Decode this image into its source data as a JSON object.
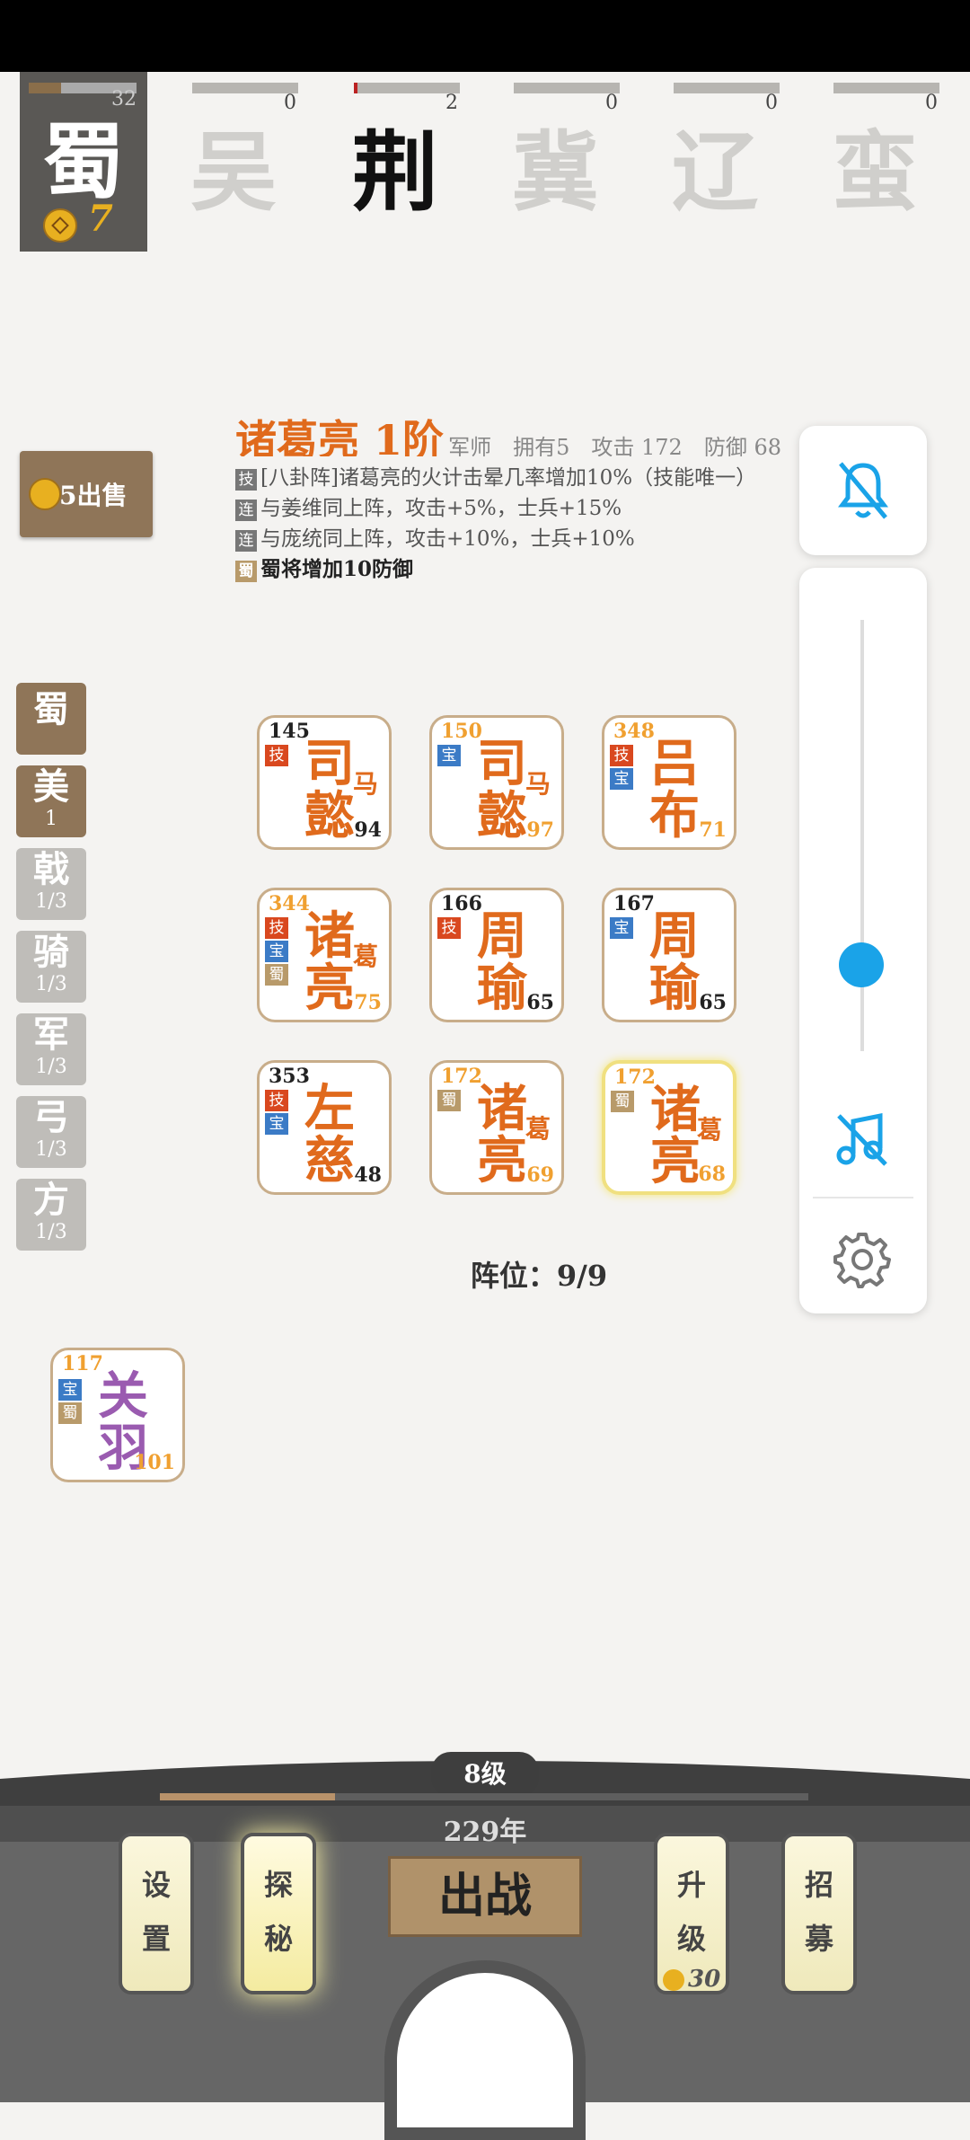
{
  "factions": [
    {
      "name": "蜀",
      "count": "32",
      "gold": "7",
      "progress": 0.3
    },
    {
      "name": "吴",
      "count": "0",
      "progress": 0
    },
    {
      "name": "荆",
      "count": "2",
      "progress": 0.03
    },
    {
      "name": "冀",
      "count": "0",
      "progress": 0
    },
    {
      "name": "辽",
      "count": "0",
      "progress": 0
    },
    {
      "name": "蛮",
      "count": "0",
      "progress": 0
    }
  ],
  "sell": {
    "label": "5出售"
  },
  "hero": {
    "name": "诸葛亮 1阶",
    "stats": "军师　拥有5　攻击 172　防御 68",
    "lines": [
      {
        "tag": "技",
        "text": "[八卦阵]诸葛亮的火计击晕几率增加10%（技能唯一）"
      },
      {
        "tag": "连",
        "text": "与姜维同上阵，攻击+5%，士兵+15%"
      },
      {
        "tag": "连",
        "text": "与庞统同上阵，攻击+10%，士兵+10%"
      },
      {
        "tag": "蜀",
        "text": "蜀将增加10防御"
      }
    ]
  },
  "filters": [
    {
      "t": "蜀",
      "s": ""
    },
    {
      "t": "美",
      "s": "1"
    },
    {
      "t": "戟",
      "s": "1/3"
    },
    {
      "t": "骑",
      "s": "1/3"
    },
    {
      "t": "军",
      "s": "1/3"
    },
    {
      "t": "弓",
      "s": "1/3"
    },
    {
      "t": "方",
      "s": "1/3"
    }
  ],
  "cards": [
    {
      "lv": "145",
      "c1": "司",
      "c2": "懿",
      "c3": "马",
      "pw": "94",
      "badges": [
        "技"
      ],
      "orange": false
    },
    {
      "lv": "150",
      "c1": "司",
      "c2": "懿",
      "c3": "马",
      "pw": "97",
      "badges": [
        "宝"
      ],
      "orange": true
    },
    {
      "lv": "348",
      "c1": "吕",
      "c2": "布",
      "c3": "",
      "pw": "71",
      "badges": [
        "技",
        "宝"
      ],
      "orange": true
    },
    {
      "lv": "344",
      "c1": "诸",
      "c2": "亮",
      "c3": "葛",
      "pw": "75",
      "badges": [
        "技",
        "宝",
        "蜀"
      ],
      "orange": true
    },
    {
      "lv": "166",
      "c1": "周",
      "c2": "瑜",
      "c3": "",
      "pw": "65",
      "badges": [
        "技"
      ],
      "orange": false
    },
    {
      "lv": "167",
      "c1": "周",
      "c2": "瑜",
      "c3": "",
      "pw": "65",
      "badges": [
        "宝"
      ],
      "orange": false
    },
    {
      "lv": "353",
      "c1": "左",
      "c2": "慈",
      "c3": "",
      "pw": "48",
      "badges": [
        "技",
        "宝"
      ],
      "orange": false
    },
    {
      "lv": "172",
      "c1": "诸",
      "c2": "亮",
      "c3": "葛",
      "pw": "69",
      "badges": [
        "蜀"
      ],
      "orange": true
    },
    {
      "lv": "172",
      "c1": "诸",
      "c2": "亮",
      "c3": "葛",
      "pw": "68",
      "badges": [
        "蜀"
      ],
      "orange": true,
      "selected": true
    }
  ],
  "formation": "阵位：9/9",
  "reserve": {
    "lv": "117",
    "c1": "关",
    "c2": "羽",
    "pw": "101",
    "badges": [
      "宝",
      "蜀"
    ]
  },
  "bottom": {
    "level": "8级",
    "level_progress": 0.27,
    "year": "229年",
    "battle": "出战",
    "settings": [
      "设",
      "置"
    ],
    "explore": [
      "探",
      "秘"
    ],
    "upgrade": [
      "升",
      "级"
    ],
    "upgrade_cost": "30",
    "recruit": [
      "招",
      "募"
    ]
  },
  "panel": {
    "volume": 0.2
  }
}
